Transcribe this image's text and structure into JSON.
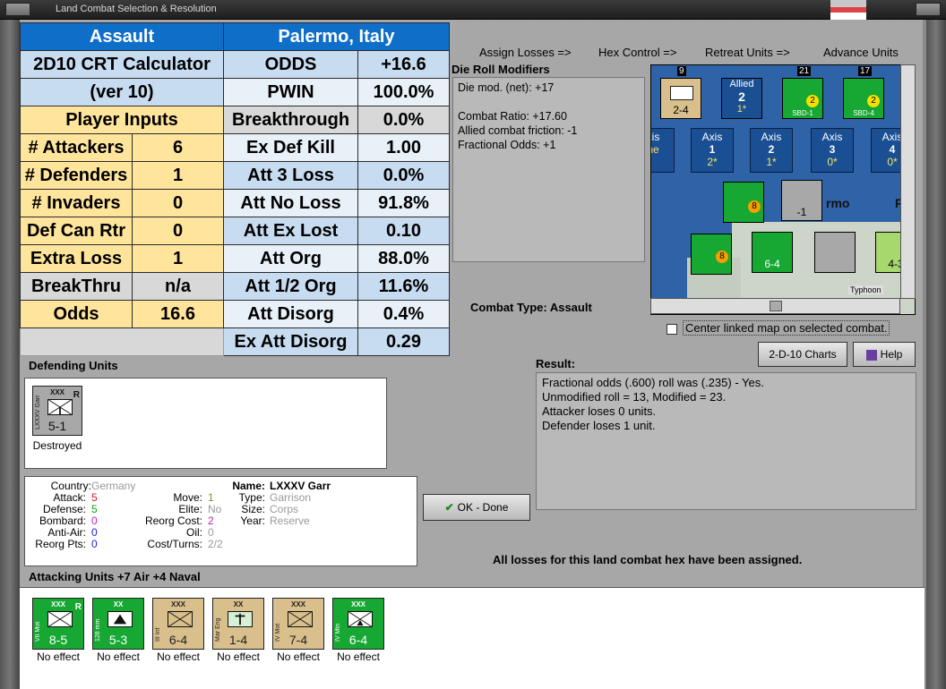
{
  "window": {
    "title": "Land Combat Selection & Resolution"
  },
  "crt": {
    "header_left": "Assault",
    "header_right": "Palermo, Italy",
    "calc_title": "2D10 CRT Calculator",
    "calc_version": "(ver 10)",
    "player_inputs": "Player Inputs",
    "inputs": [
      {
        "label": "# Attackers",
        "value": "6"
      },
      {
        "label": "# Defenders",
        "value": "1"
      },
      {
        "label": "# Invaders",
        "value": "0"
      },
      {
        "label": "Def Can Rtr",
        "value": "0"
      },
      {
        "label": "Extra Loss",
        "value": "1"
      },
      {
        "label": "BreakThru",
        "value": "n/a"
      },
      {
        "label": "Odds",
        "value": "16.6"
      }
    ],
    "outputs": [
      {
        "label": "ODDS",
        "value": "+16.6"
      },
      {
        "label": "PWIN",
        "value": "100.0%"
      },
      {
        "label": "Breakthrough",
        "value": "0.0%"
      },
      {
        "label": "Ex Def Kill",
        "value": "1.00"
      },
      {
        "label": "Att 3 Loss",
        "value": "0.0%"
      },
      {
        "label": "Att No Loss",
        "value": "91.8%"
      },
      {
        "label": "Att Ex Lost",
        "value": "0.10"
      },
      {
        "label": "Att Org",
        "value": "88.0%"
      },
      {
        "label": "Att 1/2 Org",
        "value": "11.6%"
      },
      {
        "label": "Att Disorg",
        "value": "0.4%"
      },
      {
        "label": "Ex Att Disorg",
        "value": "0.29"
      }
    ]
  },
  "toplinks": [
    "Assign Losses =>",
    "Hex Control =>",
    "Retreat Units =>",
    "Advance Units"
  ],
  "die_roll": {
    "title": "Die Roll Modifiers",
    "lines": [
      "Die mod. (net): +17",
      "",
      "Combat Ratio: +17.60",
      "Allied combat friction: -1",
      "Fractional Odds: +1"
    ]
  },
  "combat_type": "Combat Type:  Assault",
  "map": {
    "counters": [
      {
        "top": "9",
        "label": "2-4"
      },
      {
        "top": "",
        "label": "Allied",
        "value": "2",
        "sub": "1*"
      },
      {
        "top": "21",
        "label": "SBD-1"
      },
      {
        "top": "17",
        "label": "SBD-4"
      }
    ],
    "axis_boxes": [
      {
        "label": "xis",
        "value": "",
        "sub": "ne"
      },
      {
        "label": "Axis",
        "value": "1",
        "sub": "2*"
      },
      {
        "label": "Axis",
        "value": "2",
        "sub": "1*"
      },
      {
        "label": "Axis",
        "value": "3",
        "sub": "0*"
      },
      {
        "label": "Axis",
        "value": "4",
        "sub": "0*"
      }
    ],
    "hex_labels": [
      "rmo",
      "R",
      "-1",
      "6-4",
      "4-3",
      "8",
      "8",
      "Typhoon"
    ]
  },
  "center_linked": "Center linked map on selected combat.",
  "buttons": {
    "charts": "2-D-10 Charts",
    "help": "Help",
    "ok": "OK - Done"
  },
  "result": {
    "title": "Result:",
    "lines": [
      "Fractional odds (.600) roll was (.235)  - Yes.",
      "Unmodified roll = 13, Modified = 23.",
      "Attacker loses 0 units.",
      "Defender loses 1 unit."
    ]
  },
  "defending": {
    "title": "Defending Units",
    "units": [
      {
        "side": "LXXXV Garr",
        "size": "XXX",
        "value": "5-1",
        "status": "Destroyed",
        "reserve": "R"
      }
    ]
  },
  "info": {
    "country_label": "Country:",
    "country": "Germany",
    "attack_label": "Attack:",
    "attack": "5",
    "defense_label": "Defense:",
    "defense": "5",
    "bombard_label": "Bombard:",
    "bombard": "0",
    "antiair_label": "Anti-Air:",
    "antiair": "0",
    "reorgpts_label": "Reorg Pts:",
    "reorgpts": "0",
    "move_label": "Move:",
    "move": "1",
    "elite_label": "Elite:",
    "elite": "No",
    "reorgcost_label": "Reorg Cost:",
    "reorgcost": "2",
    "oil_label": "Oil:",
    "oil": "0",
    "costturns_label": "Cost/Turns:",
    "costturns": "2/2",
    "name_label": "Name:",
    "name": "LXXXV Garr",
    "type_label": "Type:",
    "type": "Garrison",
    "size_label": "Size:",
    "size": "Corps",
    "year_label": "Year:",
    "year": "Reserve"
  },
  "all_losses": "All losses for this land combat hex have been assigned.",
  "attacking": {
    "title": "Attacking Units +7 Air +4 Naval",
    "units": [
      {
        "side": "VII Mot",
        "size": "XXX",
        "value": "8-5",
        "status": "No effect",
        "color": "green",
        "reserve": "R"
      },
      {
        "side": "128 mm",
        "size": "XX",
        "value": "5-3",
        "status": "No effect",
        "color": "green",
        "reserve": ""
      },
      {
        "side": "III Inf",
        "size": "XXX",
        "value": "6-4",
        "status": "No effect",
        "color": "tan",
        "reserve": ""
      },
      {
        "side": "Mar Eng",
        "size": "XX",
        "value": "1-4",
        "status": "No effect",
        "color": "tan",
        "reserve": ""
      },
      {
        "side": "IV Mot",
        "size": "XXX",
        "value": "7-4",
        "status": "No effect",
        "color": "tan",
        "reserve": ""
      },
      {
        "side": "IV Mtn",
        "size": "XXX",
        "value": "6-4",
        "status": "No effect",
        "color": "green",
        "reserve": ""
      }
    ]
  }
}
